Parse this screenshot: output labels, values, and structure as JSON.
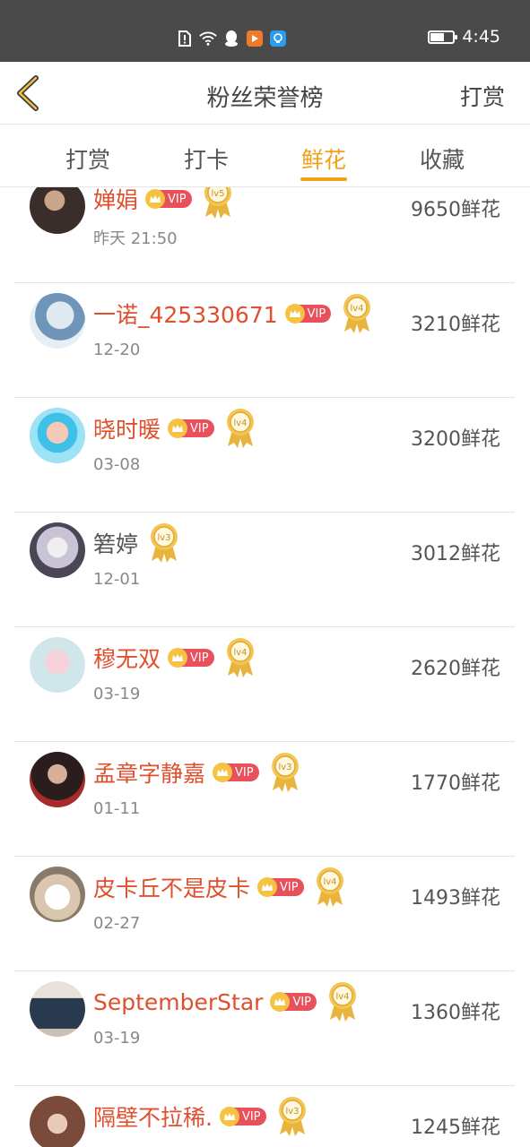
{
  "status_bar": {
    "time": "4:45"
  },
  "header": {
    "title": "粉丝荣誉榜",
    "action": "打赏"
  },
  "tabs": [
    {
      "label": "打赏"
    },
    {
      "label": "打卡"
    },
    {
      "label": "鲜花"
    },
    {
      "label": "收藏"
    }
  ],
  "active_tab": "鲜花",
  "vip_label": "VIP",
  "rows": [
    {
      "name": "婵娟",
      "vip": true,
      "level": "lv5",
      "date": "昨天 21:50",
      "amount": "9650鲜花"
    },
    {
      "name": "一诺_425330671",
      "vip": true,
      "level": "lv4",
      "date": "12-20",
      "amount": "3210鲜花"
    },
    {
      "name": "晓时暖",
      "vip": true,
      "level": "lv4",
      "date": "03-08",
      "amount": "3200鲜花"
    },
    {
      "name": "箬婷",
      "vip": false,
      "level": "lv3",
      "date": "12-01",
      "amount": "3012鲜花"
    },
    {
      "name": "穆无双",
      "vip": true,
      "level": "lv4",
      "date": "03-19",
      "amount": "2620鲜花"
    },
    {
      "name": "孟章字静嘉",
      "vip": true,
      "level": "lv3",
      "date": "01-11",
      "amount": "1770鲜花"
    },
    {
      "name": "皮卡丘不是皮卡",
      "vip": true,
      "level": "lv4",
      "date": "02-27",
      "amount": "1493鲜花"
    },
    {
      "name": "SeptemberStar",
      "vip": true,
      "level": "lv4",
      "date": "03-19",
      "amount": "1360鲜花"
    },
    {
      "name": "隔壁不拉稀.",
      "vip": true,
      "level": "lv3",
      "date": "",
      "amount": "1245鲜花"
    }
  ],
  "colors": {
    "accent": "#f0a21a",
    "name": "#e0502e",
    "vip_badge": "#e8505b",
    "status_bar": "#4a4a4a"
  }
}
